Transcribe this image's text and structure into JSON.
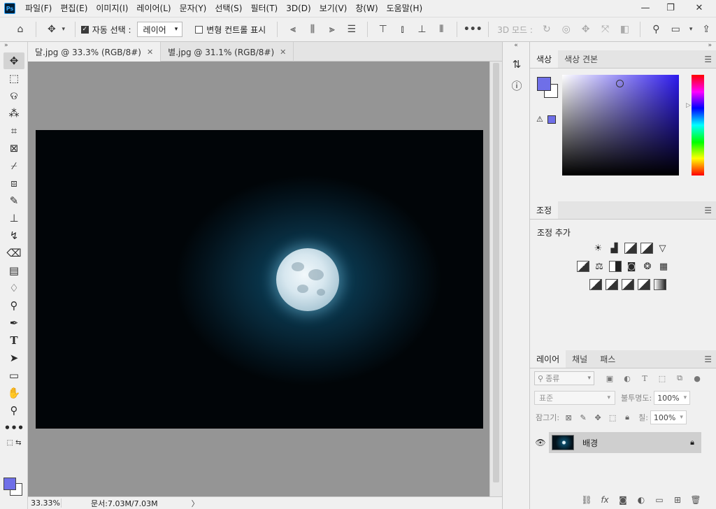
{
  "app": {
    "logo": "Ps"
  },
  "menu": [
    "파일(F)",
    "편집(E)",
    "이미지(I)",
    "레이어(L)",
    "문자(Y)",
    "선택(S)",
    "필터(T)",
    "3D(D)",
    "보기(V)",
    "창(W)",
    "도움말(H)"
  ],
  "window_controls": {
    "minimize": "—",
    "restore": "❐",
    "close": "✕"
  },
  "options": {
    "auto_select_label": "자동 선택 :",
    "auto_select_checked": true,
    "auto_select_target": "레이어",
    "transform_controls_label": "변형 컨트롤 표시",
    "transform_controls_checked": false,
    "mode_3d_label": "3D 모드 :"
  },
  "tabs": [
    {
      "label": "달.jpg @ 33.3% (RGB/8#)",
      "active": true
    },
    {
      "label": "별.jpg @ 31.1% (RGB/8#)",
      "active": false
    }
  ],
  "status": {
    "zoom": "33.33%",
    "doc_size": "문서:7.03M/7.03M"
  },
  "colors": {
    "foreground": "#6f6fe8",
    "background": "#ffffff",
    "canvas_bg": "#959595"
  },
  "color_panel": {
    "tabs": [
      "색상",
      "색상 견본"
    ],
    "active_tab": "색상"
  },
  "adjustments_panel": {
    "tab": "조정",
    "add_label": "조정 추가",
    "row1": [
      "brightness-contrast-icon",
      "levels-icon",
      "curves-icon",
      "exposure-icon",
      "vibrance-icon"
    ],
    "row2": [
      "hue-saturation-icon",
      "color-balance-icon",
      "black-white-icon",
      "photo-filter-icon",
      "channel-mixer-icon",
      "color-lookup-icon"
    ],
    "row3": [
      "invert-icon",
      "posterize-icon",
      "threshold-icon",
      "gradient-map-icon",
      "selective-color-icon"
    ]
  },
  "layers_panel": {
    "tabs": [
      "레이어",
      "채널",
      "패스"
    ],
    "active_tab": "레이어",
    "filter_kind": "종류",
    "blend_mode": "표준",
    "opacity_label": "불투명도:",
    "opacity": "100%",
    "lock_label": "잠그기:",
    "fill_label": "칠:",
    "fill": "100%",
    "layers": [
      {
        "name": "배경",
        "visible": true,
        "locked": true
      }
    ]
  }
}
